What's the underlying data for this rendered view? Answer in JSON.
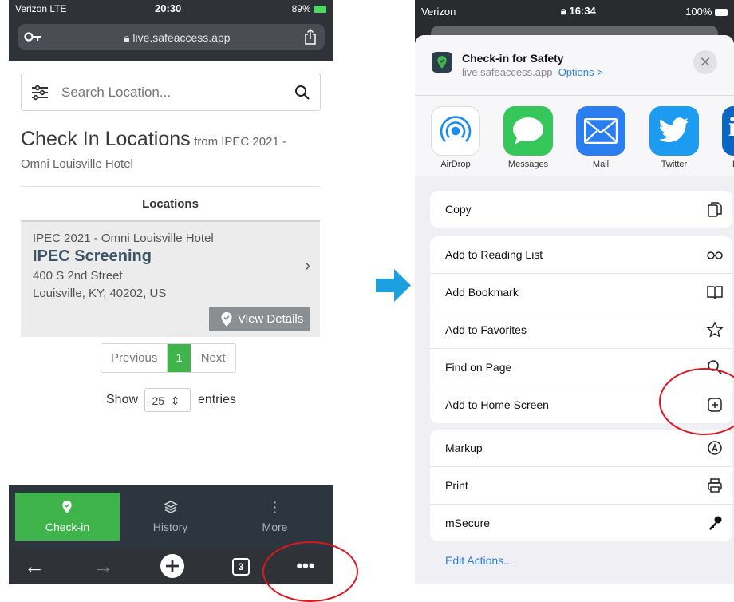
{
  "left_phone": {
    "status": {
      "carrier": "Verizon  LTE",
      "time": "20:30",
      "battery": "89%"
    },
    "url": "live.safeaccess.app",
    "search": {
      "placeholder": "Search Location..."
    },
    "page_title": "Check In Locations",
    "page_subtitle": "from IPEC 2021 -",
    "page_subtitle2": "Omni Louisville Hotel",
    "table_header": "Locations",
    "location": {
      "event": "IPEC 2021 - Omni Louisville Hotel",
      "name": "IPEC Screening",
      "address1": "400 S 2nd Street",
      "address2": "Louisville, KY, 40202, US",
      "view_details": "View Details"
    },
    "pagination": {
      "previous": "Previous",
      "current": "1",
      "next": "Next"
    },
    "show_entries": {
      "prefix": "Show",
      "value": "25",
      "suffix": "entries"
    },
    "app_nav": [
      {
        "label": "Check-in",
        "icon": "location-check-icon",
        "active": true
      },
      {
        "label": "History",
        "icon": "layers-icon",
        "active": false
      },
      {
        "label": "More",
        "icon": "vertical-dots-icon",
        "active": false
      }
    ],
    "toolbar": {
      "tabs_count": "3"
    }
  },
  "right_phone": {
    "status": {
      "carrier": "Verizon",
      "time": "16:34",
      "battery": "100%"
    },
    "share_header": {
      "title": "Check-in for Safety",
      "url": "live.safeaccess.app",
      "options": "Options >"
    },
    "apps": [
      {
        "label": "AirDrop",
        "icon": "airdrop-icon",
        "color": "#ffffff"
      },
      {
        "label": "Messages",
        "icon": "messages-icon",
        "color": "#35c759"
      },
      {
        "label": "Mail",
        "icon": "mail-icon",
        "color": "#2a7ef0"
      },
      {
        "label": "Twitter",
        "icon": "twitter-icon",
        "color": "#1d9bf0"
      },
      {
        "label": "L",
        "icon": "linkedin-icon",
        "color": "#0a66c2"
      }
    ],
    "actions_group1": [
      {
        "label": "Copy",
        "icon": "copy-icon"
      }
    ],
    "actions_group2": [
      {
        "label": "Add to Reading List",
        "icon": "glasses-icon"
      },
      {
        "label": "Add Bookmark",
        "icon": "book-icon"
      },
      {
        "label": "Add to Favorites",
        "icon": "star-icon"
      },
      {
        "label": "Find on Page",
        "icon": "search-icon"
      },
      {
        "label": "Add to Home Screen",
        "icon": "plus-square-icon"
      }
    ],
    "actions_group3": [
      {
        "label": "Markup",
        "icon": "markup-icon"
      },
      {
        "label": "Print",
        "icon": "printer-icon"
      },
      {
        "label": "mSecure",
        "icon": "key-icon"
      }
    ],
    "edit_actions": "Edit Actions..."
  },
  "colors": {
    "accent_green": "#3eb44a",
    "highlight_red": "#e0161f",
    "arrow_blue": "#1ba1e2",
    "ios_blue": "#2d7fdd"
  }
}
